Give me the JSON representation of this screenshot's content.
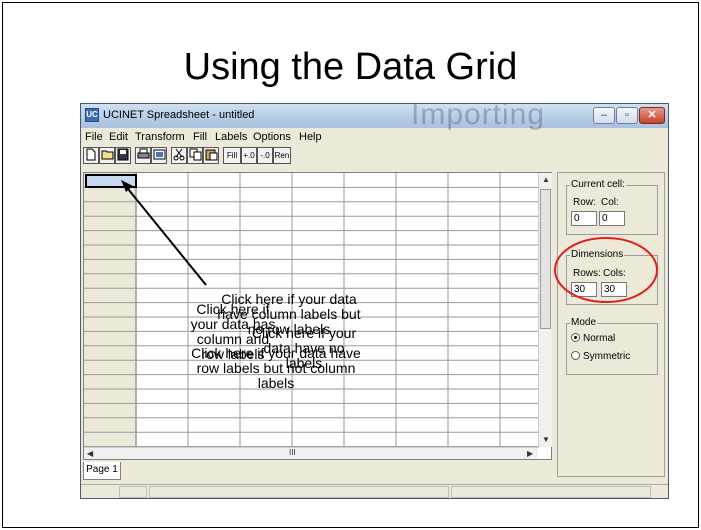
{
  "slide": {
    "title": "Using the Data Grid"
  },
  "window": {
    "title": "UCINET Spreadsheet - untitled",
    "icon_label": "UC",
    "background_text": "Importing"
  },
  "menu": [
    "File",
    "Edit",
    "Transform",
    "Fill",
    "Labels",
    "Options",
    "Help"
  ],
  "toolbar": {
    "buttons": [
      {
        "icon": "new-file-icon"
      },
      {
        "icon": "open-folder-icon"
      },
      {
        "icon": "save-disk-icon"
      },
      {
        "icon": "print-icon"
      },
      {
        "icon": "preview-icon"
      },
      {
        "icon": "cut-icon"
      },
      {
        "icon": "copy-icon"
      },
      {
        "icon": "paste-icon"
      }
    ],
    "text_buttons": [
      "Fill",
      "+.0",
      "-.0",
      "Ren"
    ]
  },
  "grid": {
    "scroll_glyph": "III"
  },
  "current_cell": {
    "title": "Current cell:",
    "row_label": "Row:",
    "col_label": "Col:",
    "row_value": "0",
    "col_value": "0"
  },
  "dimensions": {
    "title": "Dimensions",
    "rows_label": "Rows:",
    "cols_label": "Cols:",
    "rows_value": "30",
    "cols_value": "30"
  },
  "mode": {
    "title": "Mode",
    "options": [
      "Normal",
      "Symmetric"
    ],
    "selected": "Normal"
  },
  "tabs": [
    "Page 1"
  ],
  "annotations": {
    "note_1": "Click here if your data have column labels but no row labels",
    "note_2": "Click here if your data has column and row labels",
    "note_3": "Click here if your data have no labels",
    "note_4": "Click here if your data have row labels but not column labels"
  },
  "colors": {
    "highlight_circle": "#e02020",
    "selected_cell": "#c7d9f1"
  }
}
